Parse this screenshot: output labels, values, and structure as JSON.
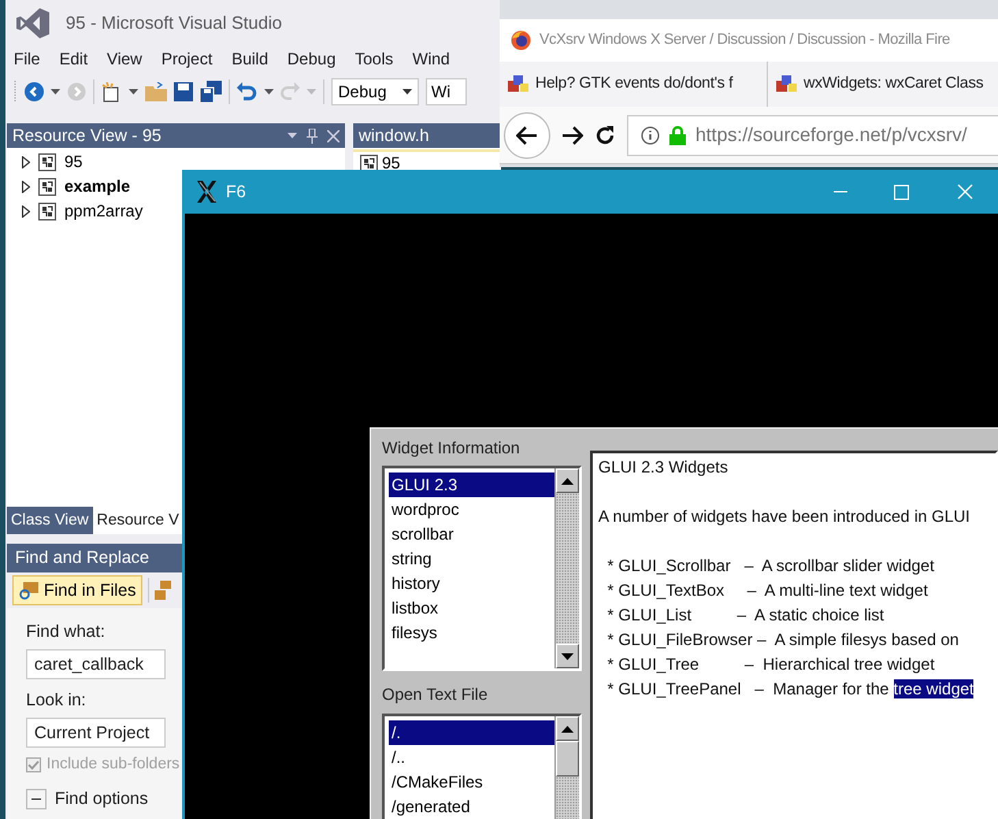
{
  "visual_studio": {
    "title": "95 - Microsoft Visual Studio",
    "menu": [
      "File",
      "Edit",
      "View",
      "Project",
      "Build",
      "Debug",
      "Tools",
      "Wind"
    ],
    "configuration": "Debug",
    "platform": "Wi",
    "resource_view": {
      "title": "Resource View - 95",
      "items": [
        {
          "label": "95",
          "bold": false
        },
        {
          "label": "example",
          "bold": true
        },
        {
          "label": "ppm2array",
          "bold": false
        }
      ]
    },
    "editor_tab": {
      "title": "window.h",
      "item": "95"
    },
    "bottom_tabs": [
      {
        "label": "Class View",
        "selected": false
      },
      {
        "label": "Resource V",
        "selected": true
      }
    ],
    "find_replace": {
      "title": "Find and Replace",
      "mode": "Find in Files",
      "find_what_label": "Find what:",
      "find_what": "caret_callback",
      "look_in_label": "Look in:",
      "look_in": "Current Project",
      "include_subfolders": {
        "label": "Include sub-folders",
        "checked": true,
        "disabled": true
      },
      "find_options": {
        "label": "Find options",
        "expanded": true
      }
    }
  },
  "firefox": {
    "title": "VcXsrv Windows X Server / Discussion / Discussion - Mozilla Fire",
    "tabs": [
      "Help? GTK events do/dont's f",
      "wxWidgets: wxCaret Class"
    ],
    "url": "https://sourceforge.net/p/vcxsrv/"
  },
  "x_window": {
    "title": "F6",
    "widget_info": {
      "label": "Widget Information",
      "items": [
        {
          "label": "GLUI 2.3",
          "selected": true
        },
        {
          "label": "wordproc",
          "selected": false
        },
        {
          "label": "scrollbar",
          "selected": false
        },
        {
          "label": "string",
          "selected": false
        },
        {
          "label": "history",
          "selected": false
        },
        {
          "label": "listbox",
          "selected": false
        },
        {
          "label": "filesys",
          "selected": false
        }
      ]
    },
    "open_file": {
      "label": "Open Text File",
      "items": [
        {
          "label": "/.",
          "selected": true
        },
        {
          "label": "/..",
          "selected": false
        },
        {
          "label": "/CMakeFiles",
          "selected": false
        },
        {
          "label": "/generated",
          "selected": false
        }
      ]
    },
    "text_lines": [
      {
        "kind": "heading",
        "text": "GLUI 2.3 Widgets"
      },
      {
        "kind": "paragraph",
        "text": "A number of widgets have been introduced in GLUI"
      },
      {
        "kind": "item",
        "text": "  * GLUI_Scrollbar   –  A scrollbar slider widget"
      },
      {
        "kind": "item",
        "text": "  * GLUI_TextBox     –  A multi-line text widget"
      },
      {
        "kind": "item",
        "text": "  * GLUI_List          –  A static choice list"
      },
      {
        "kind": "item",
        "text": "  * GLUI_FileBrowser –  A simple filesys based on"
      },
      {
        "kind": "item",
        "text": "  * GLUI_Tree          –  Hierarchical tree widget"
      },
      {
        "kind": "item",
        "text": "  * GLUI_TreePanel   –  Manager for the ",
        "selection": "tree widget"
      }
    ]
  }
}
